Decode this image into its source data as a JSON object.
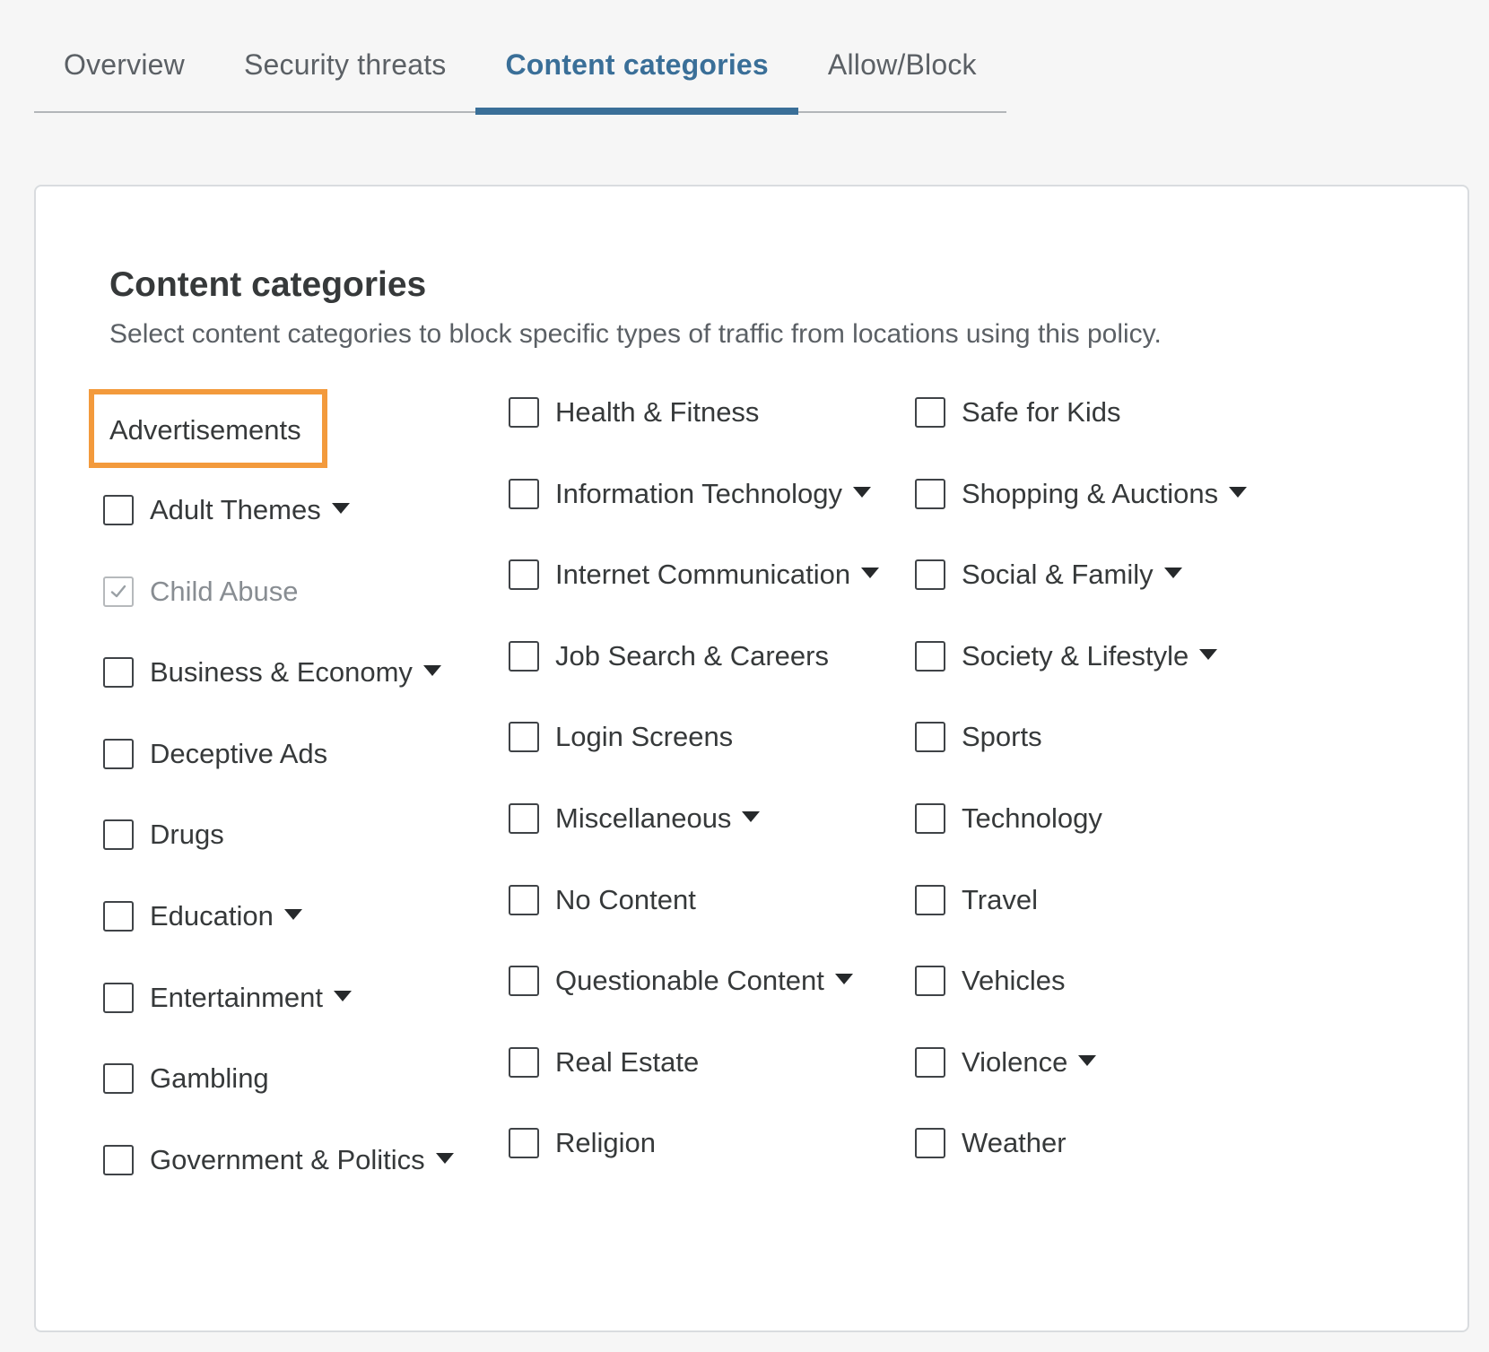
{
  "tabs": [
    {
      "label": "Overview"
    },
    {
      "label": "Security threats"
    },
    {
      "label": "Content categories"
    },
    {
      "label": "Allow/Block"
    }
  ],
  "active_tab": "Content categories",
  "card": {
    "title": "Content categories",
    "description": "Select content categories to block specific types of traffic from locations using this policy."
  },
  "highlighted": {
    "label": "Advertisements"
  },
  "highlight_color": "#f39a3c",
  "accent_color": "#3a6f98",
  "columns": [
    [
      {
        "label": "Adult Themes",
        "dropdown": true,
        "checked": false,
        "disabled": false
      },
      {
        "label": "Child Abuse",
        "dropdown": false,
        "checked": true,
        "disabled": true
      },
      {
        "label": "Business & Economy",
        "dropdown": true,
        "checked": false,
        "disabled": false
      },
      {
        "label": "Deceptive Ads",
        "dropdown": false,
        "checked": false,
        "disabled": false
      },
      {
        "label": "Drugs",
        "dropdown": false,
        "checked": false,
        "disabled": false
      },
      {
        "label": "Education",
        "dropdown": true,
        "checked": false,
        "disabled": false
      },
      {
        "label": "Entertainment",
        "dropdown": true,
        "checked": false,
        "disabled": false
      },
      {
        "label": "Gambling",
        "dropdown": false,
        "checked": false,
        "disabled": false
      },
      {
        "label": "Government & Politics",
        "dropdown": true,
        "checked": false,
        "disabled": false
      }
    ],
    [
      {
        "label": "Health & Fitness",
        "dropdown": false,
        "checked": false,
        "disabled": false
      },
      {
        "label": "Information Technology",
        "dropdown": true,
        "checked": false,
        "disabled": false
      },
      {
        "label": "Internet Communication",
        "dropdown": true,
        "checked": false,
        "disabled": false
      },
      {
        "label": "Job Search & Careers",
        "dropdown": false,
        "checked": false,
        "disabled": false
      },
      {
        "label": "Login Screens",
        "dropdown": false,
        "checked": false,
        "disabled": false
      },
      {
        "label": "Miscellaneous",
        "dropdown": true,
        "checked": false,
        "disabled": false
      },
      {
        "label": "No Content",
        "dropdown": false,
        "checked": false,
        "disabled": false
      },
      {
        "label": "Questionable Content",
        "dropdown": true,
        "checked": false,
        "disabled": false
      },
      {
        "label": "Real Estate",
        "dropdown": false,
        "checked": false,
        "disabled": false
      },
      {
        "label": "Religion",
        "dropdown": false,
        "checked": false,
        "disabled": false
      }
    ],
    [
      {
        "label": "Safe for Kids",
        "dropdown": false,
        "checked": false,
        "disabled": false
      },
      {
        "label": "Shopping & Auctions",
        "dropdown": true,
        "checked": false,
        "disabled": false
      },
      {
        "label": "Social & Family",
        "dropdown": true,
        "checked": false,
        "disabled": false
      },
      {
        "label": "Society & Lifestyle",
        "dropdown": true,
        "checked": false,
        "disabled": false
      },
      {
        "label": "Sports",
        "dropdown": false,
        "checked": false,
        "disabled": false
      },
      {
        "label": "Technology",
        "dropdown": false,
        "checked": false,
        "disabled": false
      },
      {
        "label": "Travel",
        "dropdown": false,
        "checked": false,
        "disabled": false
      },
      {
        "label": "Vehicles",
        "dropdown": false,
        "checked": false,
        "disabled": false
      },
      {
        "label": "Violence",
        "dropdown": true,
        "checked": false,
        "disabled": false
      },
      {
        "label": "Weather",
        "dropdown": false,
        "checked": false,
        "disabled": false
      }
    ]
  ]
}
